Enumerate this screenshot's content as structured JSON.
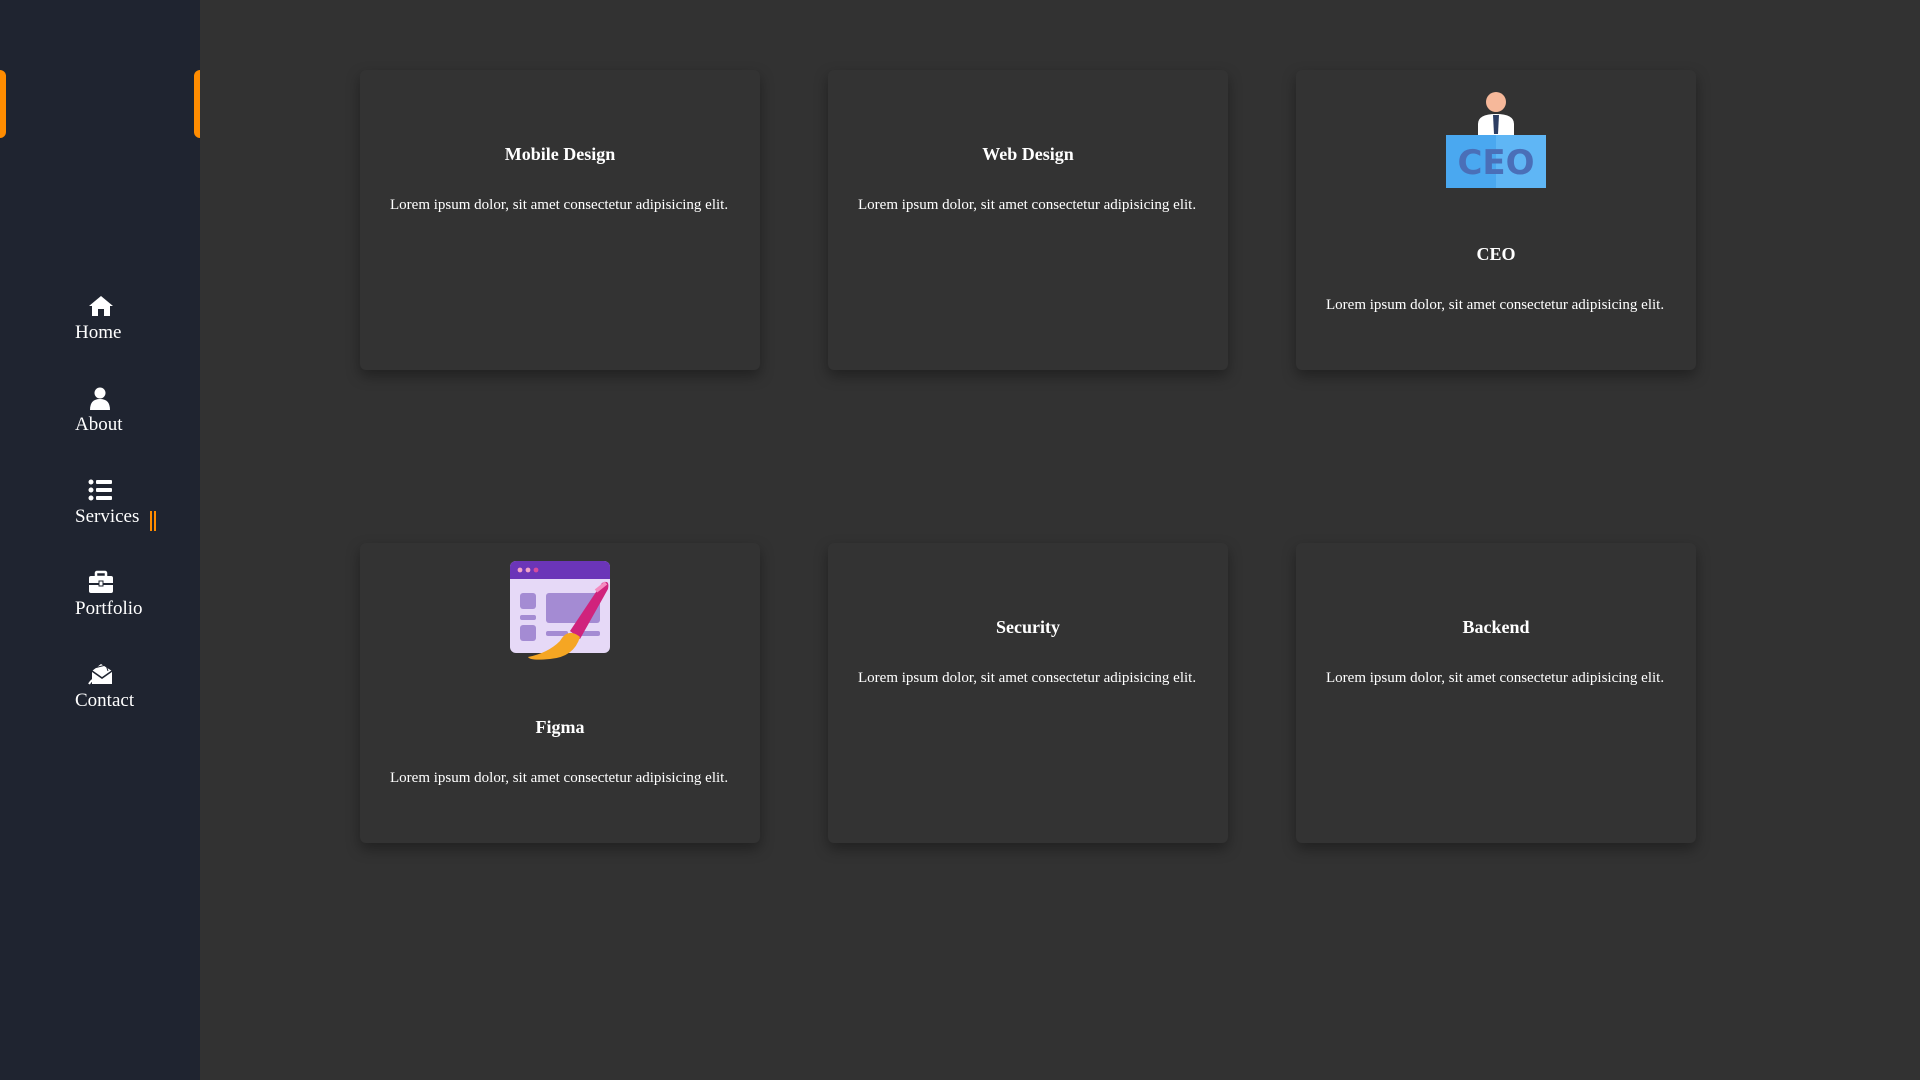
{
  "sidebar": {
    "accent_color": "#ff8c00",
    "items": [
      {
        "label": "Home",
        "icon": "home-icon",
        "active": false
      },
      {
        "label": "About",
        "icon": "user-icon",
        "active": false
      },
      {
        "label": "Services",
        "icon": "list-icon",
        "active": true
      },
      {
        "label": "Portfolio",
        "icon": "briefcase-icon",
        "active": false
      },
      {
        "label": "Contact",
        "icon": "mail-icon",
        "active": false
      }
    ]
  },
  "cards": [
    {
      "title": "Mobile Design",
      "text": "Lorem ipsum dolor, sit amet consectetur adipisicing elit.",
      "image": ""
    },
    {
      "title": "Web Design",
      "text": "Lorem ipsum dolor, sit amet consectetur adipisicing elit.",
      "image": ""
    },
    {
      "title": "CEO",
      "text": "Lorem ipsum dolor, sit amet consectetur adipisicing elit.",
      "image": "ceo-illustration"
    },
    {
      "title": "Figma",
      "text": "Lorem ipsum dolor, sit amet consectetur adipisicing elit.",
      "image": "figma-illustration"
    },
    {
      "title": "Security",
      "text": "Lorem ipsum dolor, sit amet consectetur adipisicing elit.",
      "image": ""
    },
    {
      "title": "Backend",
      "text": "Lorem ipsum dolor, sit amet consectetur adipisicing elit.",
      "image": ""
    }
  ]
}
